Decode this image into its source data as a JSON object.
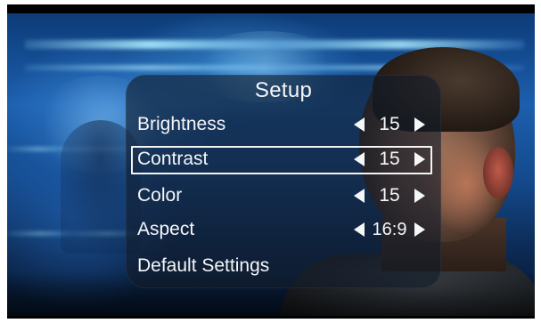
{
  "menu": {
    "title": "Setup",
    "selected_index": 1,
    "items": [
      {
        "label": "Brightness",
        "value": "15"
      },
      {
        "label": "Contrast",
        "value": "15"
      },
      {
        "label": "Color",
        "value": "15"
      },
      {
        "label": "Aspect",
        "value": "16:9"
      },
      {
        "label": "Default Settings"
      }
    ]
  },
  "icons": {
    "decrease": "left-arrow-icon",
    "increase": "right-arrow-icon"
  },
  "colors": {
    "text": "#f4f6f8",
    "panel": "rgba(18,28,42,0.62)",
    "selection_border": "#f4f4f4"
  }
}
